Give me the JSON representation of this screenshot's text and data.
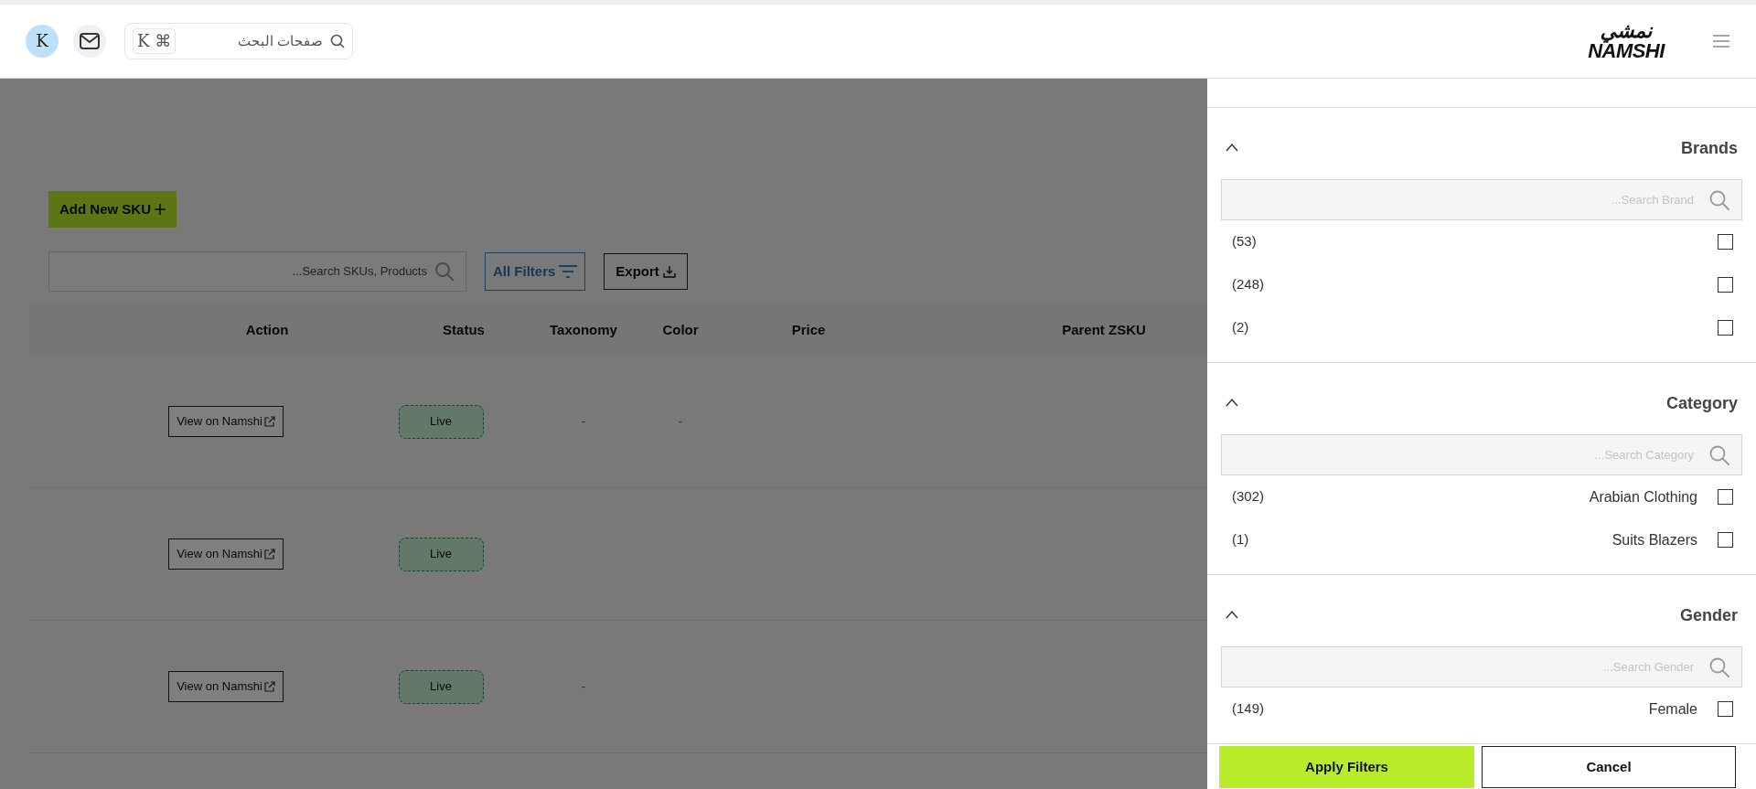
{
  "topbar": {
    "avatar": "K",
    "logo": {
      "arabic": "نمشي",
      "latin": "NAMSHI"
    },
    "search": {
      "placeholder": "صفحات البحث"
    },
    "shortcut": [
      "K",
      "⌘"
    ]
  },
  "page": {
    "add_button": "Add New SKU",
    "search": {
      "placeholder": "...Search SKUs, Products"
    },
    "filters_button": "All Filters",
    "export_button": "Export"
  },
  "table": {
    "columns": [
      "Action",
      "Status",
      "Taxonomy",
      "Color",
      "Price",
      "Parent ZSKU"
    ],
    "rows": [
      {
        "action": "View on Namshi",
        "status": "Live",
        "taxonomy": "-",
        "color_col": "-"
      },
      {
        "action": "View on Namshi",
        "status": "Live"
      },
      {
        "action": "View on Namshi",
        "status": "Live",
        "taxonomy": "-"
      }
    ]
  },
  "filter_panel": {
    "sections": [
      {
        "title": "Brands",
        "expanded": true,
        "search_placeholder": "...Search Brand",
        "options": [
          {
            "count": "(53)",
            "checked": false
          },
          {
            "count": "(248)",
            "checked": false
          },
          {
            "count": "(2)",
            "checked": false
          }
        ]
      },
      {
        "title": "Category",
        "expanded": true,
        "search_placeholder": "...Search Category",
        "options": [
          {
            "count": "(302)",
            "label": "Arabian Clothing",
            "checked": false
          },
          {
            "count": "(1)",
            "label": "Suits Blazers",
            "checked": false
          }
        ]
      },
      {
        "title": "Gender",
        "expanded": true,
        "search_placeholder": "...Search Gender",
        "options": [
          {
            "count": "(149)",
            "label": "Female",
            "checked": false
          }
        ]
      }
    ],
    "apply_button": "Apply Filters",
    "cancel_button": "Cancel"
  }
}
